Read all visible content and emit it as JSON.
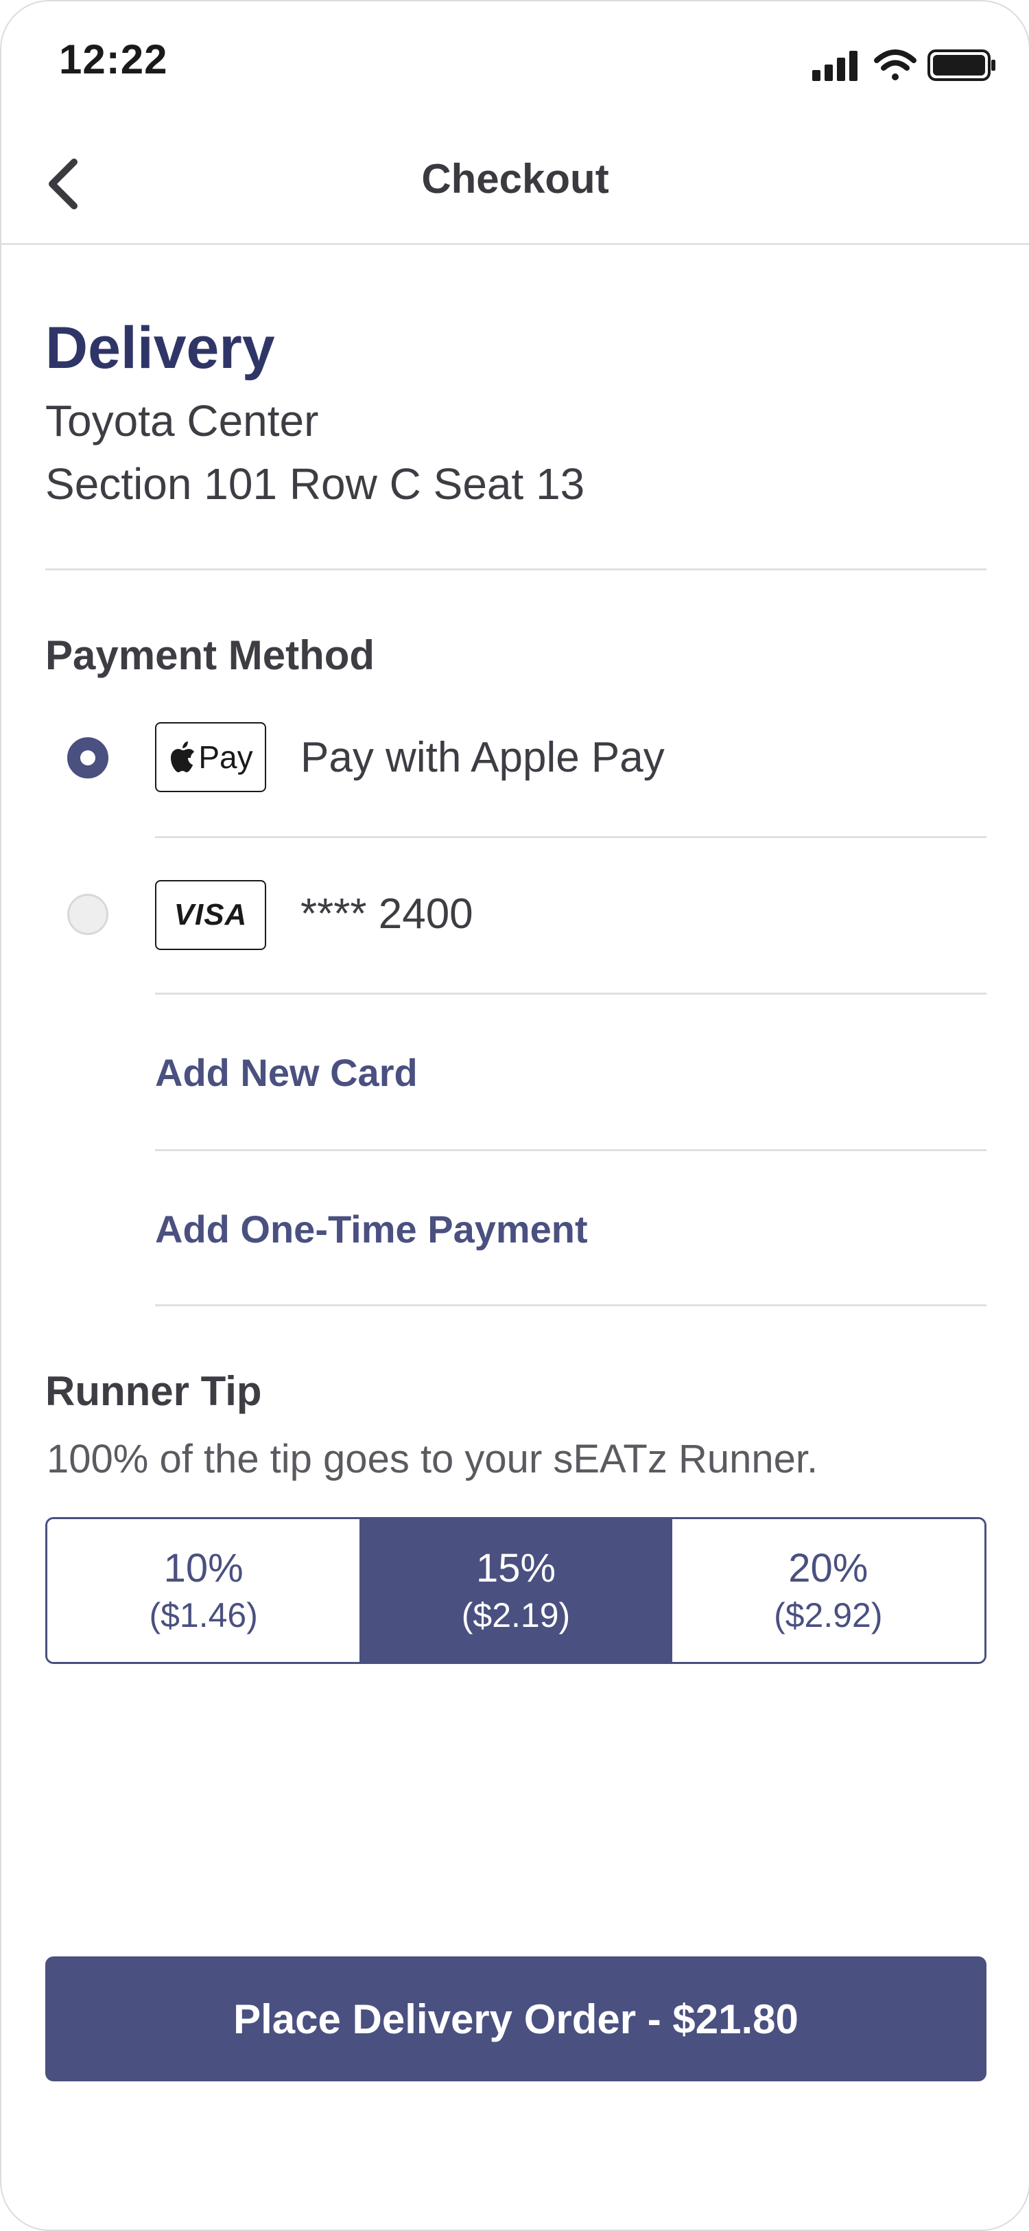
{
  "status_bar": {
    "time": "12:22"
  },
  "nav": {
    "title": "Checkout"
  },
  "delivery": {
    "title": "Delivery",
    "venue": "Toyota Center",
    "seat": "Section 101 Row C Seat 13"
  },
  "payment": {
    "heading": "Payment Method",
    "options": [
      {
        "badge": "Pay",
        "label": "Pay with Apple Pay",
        "selected": true
      },
      {
        "badge": "VISA",
        "label": "**** 2400",
        "selected": false
      }
    ],
    "add_card": "Add New Card",
    "add_one_time": "Add One-Time Payment"
  },
  "tip": {
    "heading": "Runner Tip",
    "subtitle": "100% of the tip goes to your sEATz Runner.",
    "options": [
      {
        "percent": "10%",
        "amount": "($1.46)",
        "selected": false
      },
      {
        "percent": "15%",
        "amount": "($2.19)",
        "selected": true
      },
      {
        "percent": "20%",
        "amount": "($2.92)",
        "selected": false
      }
    ]
  },
  "cta": {
    "label": "Place Delivery Order - $21.80"
  },
  "colors": {
    "accent": "#4a5080",
    "title": "#2f3667"
  }
}
